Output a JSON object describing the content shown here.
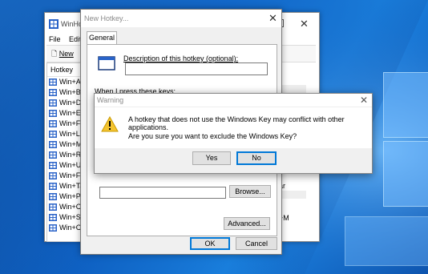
{
  "desktop": {
    "accent": "#0d63c9"
  },
  "winhotkey": {
    "title": "WinHotkey",
    "menu": [
      "File",
      "Edit"
    ],
    "toolbar_new": "New",
    "list_header": "Hotkey",
    "rows": [
      "Win+A",
      "Win+B",
      "Win+D",
      "Win+E",
      "Win+F",
      "Win+L",
      "Win+M",
      "Win+R",
      "Win+U",
      "Win+F1",
      "Win+Tab",
      "Win+Pause",
      "Win+Ctrl",
      "Win+Shift",
      "Win+Ctrl"
    ],
    "right_fragments": [
      "ar",
      "+M"
    ]
  },
  "new_hotkey": {
    "title": "New Hotkey...",
    "tab": "General",
    "description_label": "Description of this hotkey (optional):",
    "description_value": "",
    "press_label": "When I press these keys:",
    "path_value": "",
    "browse_label": "Browse...",
    "advanced_label": "Advanced...",
    "ok_label": "OK",
    "cancel_label": "Cancel"
  },
  "warning": {
    "title": "Warning",
    "line1": "A hotkey that does not use the Windows Key may conflict with other applications.",
    "line2": "Are you sure you want to exclude the Windows Key?",
    "yes_label": "Yes",
    "no_label": "No",
    "icon": "warning-triangle-icon"
  }
}
